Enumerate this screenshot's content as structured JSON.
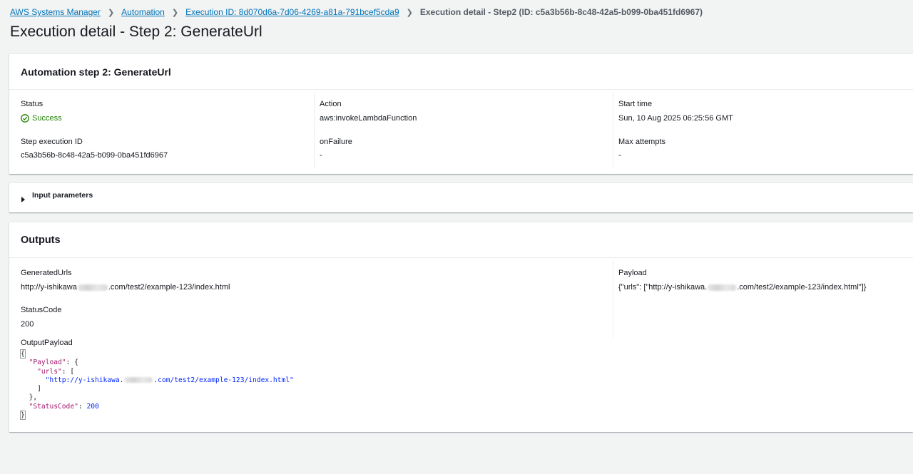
{
  "breadcrumb": {
    "items": [
      "AWS Systems Manager",
      "Automation",
      "Execution ID: 8d070d6a-7d06-4269-a81a-791bcef5cda9"
    ],
    "current": "Execution detail - Step2 (ID: c5a3b56b-8c48-42a5-b099-0ba451fd6967)"
  },
  "page_title": "Execution detail - Step 2: GenerateUrl",
  "step_panel": {
    "title": "Automation step 2: GenerateUrl",
    "status_label": "Status",
    "status_value": "Success",
    "action_label": "Action",
    "action_value": "aws:invokeLambdaFunction",
    "start_time_label": "Start time",
    "start_time_value": "Sun, 10 Aug 2025 06:25:56 GMT",
    "step_execution_id_label": "Step execution ID",
    "step_execution_id_value": "c5a3b56b-8c48-42a5-b099-0ba451fd6967",
    "on_failure_label": "onFailure",
    "on_failure_value": "-",
    "max_attempts_label": "Max attempts",
    "max_attempts_value": "-"
  },
  "input_parameters": {
    "label": "Input parameters"
  },
  "outputs": {
    "title": "Outputs",
    "generated_urls_label": "GeneratedUrls",
    "generated_urls_prefix": "http://y-ishikawa",
    "generated_urls_suffix": ".com/test2/example-123/index.html",
    "payload_label": "Payload",
    "payload_prefix": "{\"urls\": [\"http://y-ishikawa.",
    "payload_suffix": ".com/test2/example-123/index.html\"]}",
    "status_code_label": "StatusCode",
    "status_code_value": "200",
    "output_payload_label": "OutputPayload",
    "json": {
      "open": "{",
      "payload_key": "\"Payload\"",
      "payload_open": ": {",
      "urls_key": "\"urls\"",
      "urls_open": ": [",
      "url_prefix": "\"http://y-ishikawa.",
      "url_suffix": ".com/test2/example-123/index.html\"",
      "urls_close": "]",
      "payload_close": "},",
      "status_code_key": "\"StatusCode\"",
      "status_code_sep": ": ",
      "status_code_value": "200",
      "close": "}"
    }
  },
  "colors": {
    "link": "#0073bb",
    "success": "#1d8102",
    "json_key": "#a1176c",
    "json_value": "#0026ff"
  },
  "icons": {
    "breadcrumb_separator": "chevron-right-icon",
    "status": "check-circle-icon",
    "expander": "caret-right-icon"
  }
}
